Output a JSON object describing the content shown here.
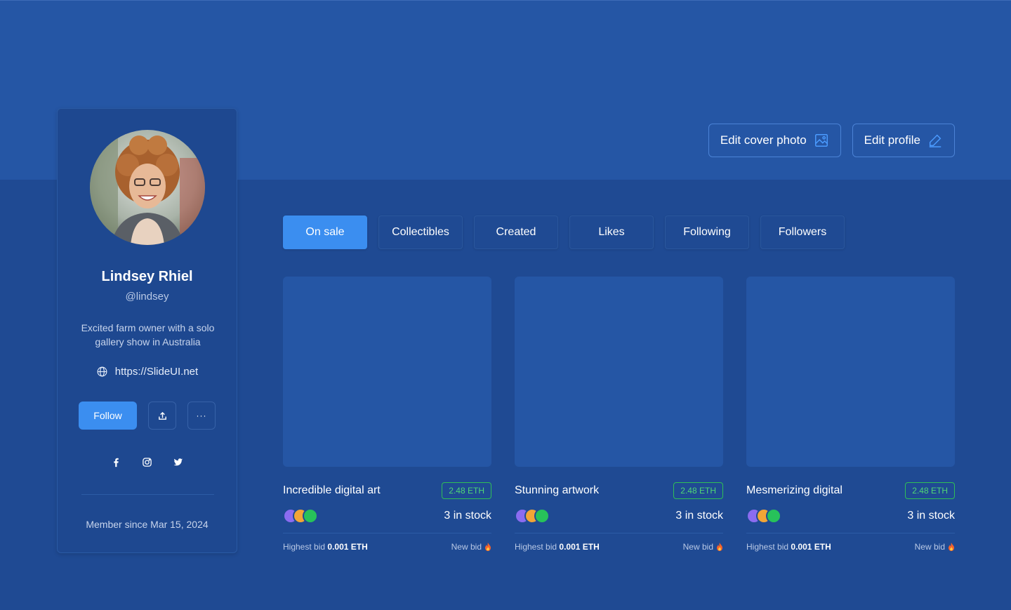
{
  "cover": {
    "edit_cover_label": "Edit cover photo",
    "edit_profile_label": "Edit profile"
  },
  "profile": {
    "name": "Lindsey Rhiel",
    "handle": "@lindsey",
    "bio": "Excited farm owner with a solo gallery show in Australia",
    "website": "https://SlideUI.net",
    "follow_label": "Follow",
    "more_label": "···",
    "member_since": "Member since Mar 15, 2024"
  },
  "tabs": [
    {
      "label": "On sale",
      "active": true
    },
    {
      "label": "Collectibles"
    },
    {
      "label": "Created"
    },
    {
      "label": "Likes"
    },
    {
      "label": "Following"
    },
    {
      "label": "Followers"
    }
  ],
  "cards": [
    {
      "title": "Incredible digital art",
      "price": "2.48 ETH",
      "stock": "3 in stock",
      "bid_label": "Highest bid",
      "bid_value": "0.001 ETH",
      "new_bid": "New bid"
    },
    {
      "title": "Stunning artwork",
      "price": "2.48 ETH",
      "stock": "3 in stock",
      "bid_label": "Highest bid",
      "bid_value": "0.001 ETH",
      "new_bid": "New bid"
    },
    {
      "title": "Mesmerizing digital",
      "price": "2.48 ETH",
      "stock": "3 in stock",
      "bid_label": "Highest bid",
      "bid_value": "0.001 ETH",
      "new_bid": "New bid"
    }
  ],
  "colors": {
    "accent": "#3b8ef0",
    "price_green": "#2fbf57",
    "bidder_dots": [
      "#8b6cf0",
      "#f3a536",
      "#27c25a"
    ]
  },
  "icons": {
    "edit_cover": "image-icon",
    "edit_profile": "pencil-icon",
    "website": "globe-icon",
    "share": "upload-icon",
    "socials": [
      "facebook-icon",
      "instagram-icon",
      "twitter-icon"
    ],
    "new_bid": "fire-icon"
  }
}
